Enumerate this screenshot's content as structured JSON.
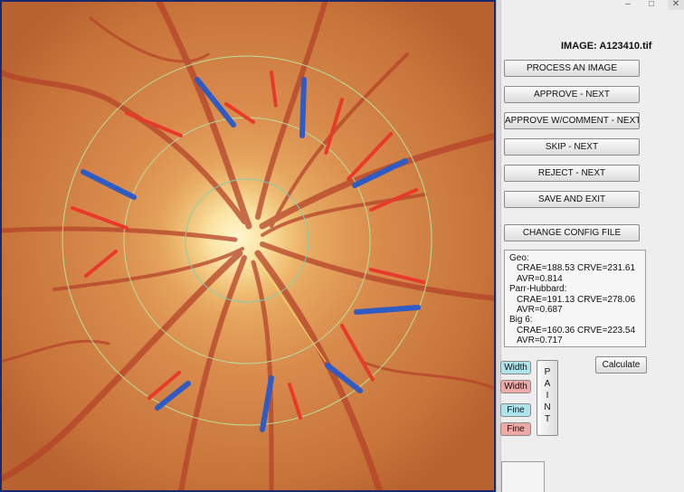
{
  "window_controls": {
    "minimize": "–",
    "maximize": "□",
    "close": "✕"
  },
  "image_title": "IMAGE: A123410.tif",
  "buttons": {
    "process": "PROCESS AN IMAGE",
    "approve": "APPROVE - NEXT",
    "approve_comment": "APPROVE W/COMMENT - NEXT",
    "skip": "SKIP - NEXT",
    "reject": "REJECT - NEXT",
    "save_exit": "SAVE AND EXIT",
    "change_config": "CHANGE CONFIG FILE",
    "calculate": "Calculate"
  },
  "results": {
    "geo": {
      "heading": "Geo:",
      "crae_crve": "CRAE=188.53 CRVE=231.61",
      "avr": "AVR=0.814"
    },
    "parr": {
      "heading": "Parr-Hubbard:",
      "crae_crve": "CRAE=191.13 CRVE=278.06",
      "avr": "AVR=0.687"
    },
    "big6": {
      "heading": "Big 6:",
      "crae_crve": "CRAE=160.36 CRVE=223.54",
      "avr": "AVR=0.717"
    }
  },
  "tool_tags": {
    "blue_width": "Width",
    "red_width": "Width",
    "blue_fine": "Fine",
    "red_fine": "Fine"
  },
  "paint_letters": [
    "P",
    "A",
    "I",
    "N",
    "T"
  ],
  "colors": {
    "artery_marker": "#e8392a",
    "vein_marker": "#2e5bc4",
    "zone_circle": "#b8e0a0",
    "tag_blue": "#aee4ec",
    "tag_red": "#efaaa8",
    "fundus_border": "#1a2a6a"
  }
}
